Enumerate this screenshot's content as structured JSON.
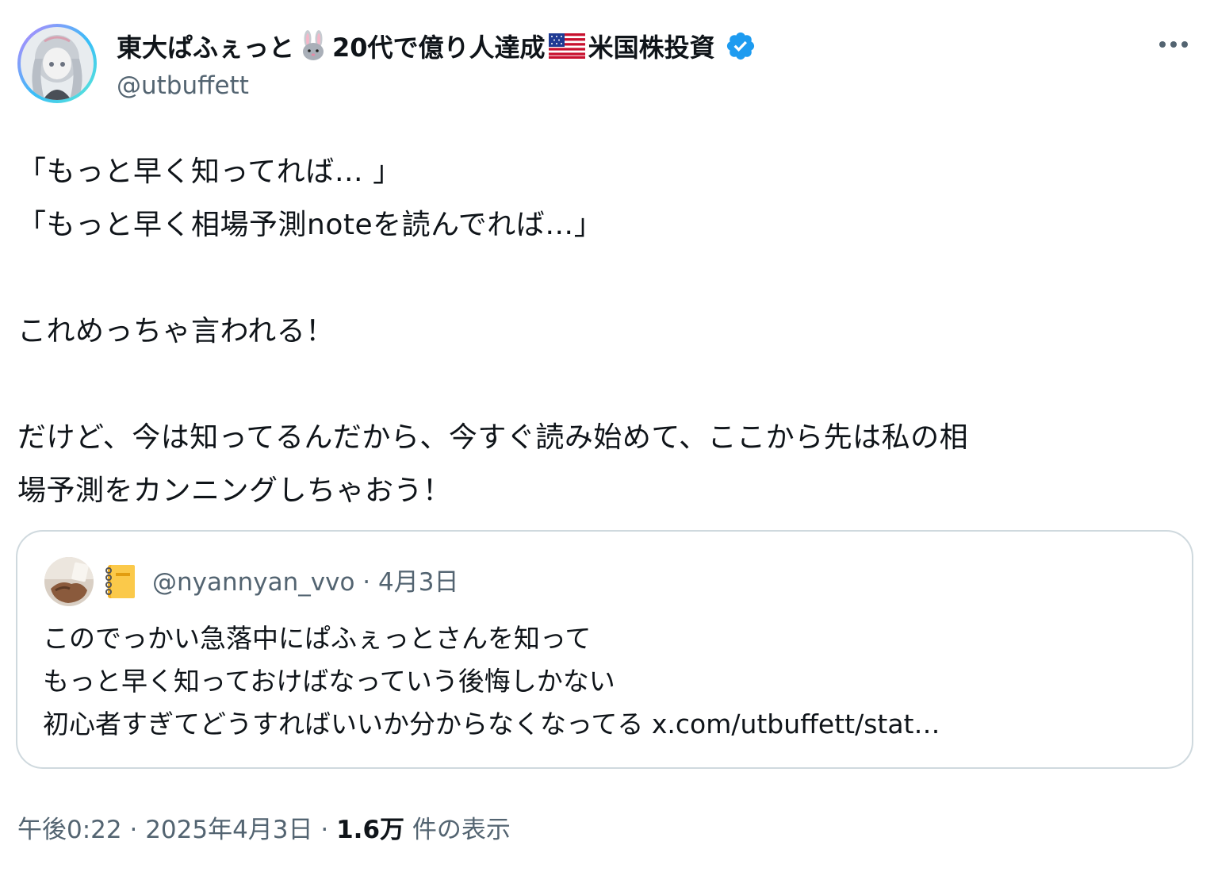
{
  "author": {
    "name_part1": "東大ぱふぇっと",
    "name_part2": "20代で億り人達成",
    "name_part3": "米国株投資",
    "handle": "@utbuffett",
    "icons": [
      "rabbit-emoji",
      "us-flag-emoji",
      "verified-badge-icon"
    ]
  },
  "tweet": {
    "lines": [
      "「もっと早く知ってれば… 」",
      "「もっと早く相場予測noteを読んでれば…」",
      "",
      "これめっちゃ言われる！",
      "",
      "だけど、今は知ってるんだから、今すぐ読み始めて、ここから先は私の相",
      "場予測をカンニングしちゃおう！"
    ]
  },
  "quote": {
    "handle": "@nyannyan_vvo",
    "separator": " · ",
    "date": "4月3日",
    "lines": [
      "このでっかい急落中にぱふぇっとさんを知って",
      "もっと早く知っておけばなっていう後悔しかない",
      "初心者すぎてどうすればいいか分からなくなってる x.com/utbuffett/stat…"
    ],
    "icons": [
      "notebook-emoji"
    ]
  },
  "footer": {
    "time": "午後0:22",
    "separator": " · ",
    "date": "2025年4月3日",
    "views_count": "1.6万",
    "views_label": " 件の表示"
  },
  "colors": {
    "text": "#0f1419",
    "secondary": "#536471",
    "verified": "#1d9bf0",
    "border": "#cfd9de"
  }
}
